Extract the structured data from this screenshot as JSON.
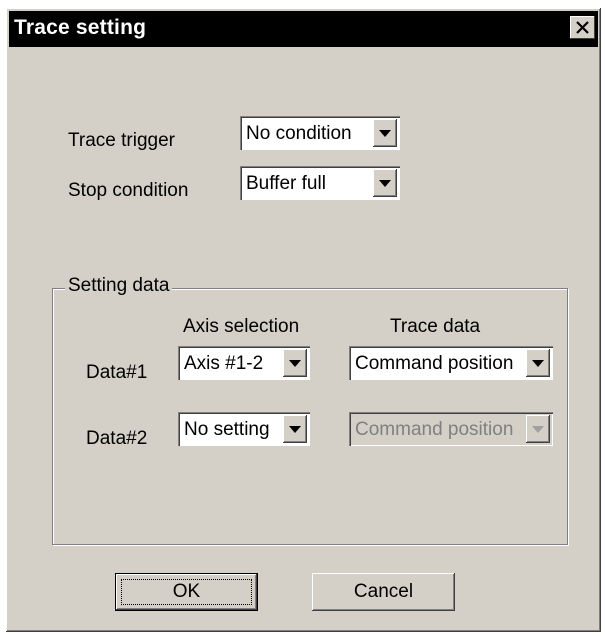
{
  "window": {
    "title": "Trace setting"
  },
  "trace_trigger": {
    "label": "Trace trigger",
    "value": "No condition"
  },
  "stop_condition": {
    "label": "Stop condition",
    "value": "Buffer full"
  },
  "setting_data": {
    "group_title": "Setting data",
    "col_axis_header": "Axis selection",
    "col_trace_header": "Trace data",
    "rows": [
      {
        "label": "Data#1",
        "axis": "Axis #1-2",
        "trace": "Command position",
        "trace_enabled": true
      },
      {
        "label": "Data#2",
        "axis": "No setting",
        "trace": "Command position",
        "trace_enabled": false
      }
    ]
  },
  "buttons": {
    "ok": "OK",
    "cancel": "Cancel"
  },
  "colors": {
    "face": "#d4d0c8",
    "titlebar": "#000000",
    "disabled_text": "#808080"
  }
}
